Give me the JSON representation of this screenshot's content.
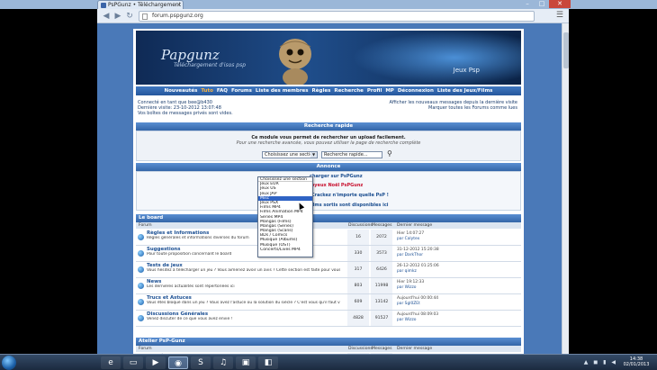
{
  "browser": {
    "tab_title": "PsPGunz • Téléchargement",
    "url": "forum.pspgunz.org",
    "window_buttons": [
      "–",
      "□",
      "✕"
    ]
  },
  "banner": {
    "logo": "Papgunz",
    "logo_sub": "Téléchargement d'isos psp",
    "right_text": "Jeux Psp"
  },
  "navbar": [
    {
      "label": "Nouveautés",
      "highlight": false
    },
    {
      "label": "Tuto",
      "highlight": true
    },
    {
      "label": "FAQ",
      "highlight": false
    },
    {
      "label": "Forums",
      "highlight": false
    },
    {
      "label": "Liste des membres",
      "highlight": false
    },
    {
      "label": "Règles",
      "highlight": false
    },
    {
      "label": "Recherche",
      "highlight": false
    },
    {
      "label": "Profil",
      "highlight": false
    },
    {
      "label": "MP",
      "highlight": false
    },
    {
      "label": "Déconnexion",
      "highlight": false
    },
    {
      "label": "Liste des Jeux/Films",
      "highlight": false
    }
  ],
  "info": {
    "left_lines": [
      "Connecté en tant que bee@b430",
      "Dernière visite: 23-10-2012 13:07:48",
      "Vos boîtes de messages privés sont vides."
    ],
    "right_lines": [
      "Afficher les nouveaux messages depuis la dernière visite",
      "Marquer toutes les Forums comme lues"
    ]
  },
  "quick_search": {
    "header": "Recherche rapide",
    "line1": "Ce module vous permet de rechercher un upload facilement.",
    "line2": "Pour une recherche avancée, vous pouvez utiliser la page de recherche complète",
    "select_value": "Choisissez une section",
    "search_value": "Recherche rapide...",
    "dropdown_options": [
      "Choisissez une section",
      "Jeux EUR",
      "Jeux US",
      "Jeux JAP",
      "Misc",
      "Jeux PSX",
      "Films MP4",
      "Films Animation MP4",
      "Series MP4",
      "Mangas (Films)",
      "Mangas (Series)",
      "Mangas (Scans)",
      "BDs / Comics",
      "Musique (Albums)",
      "Musique (OST)",
      "Concerts/Lives MP4"
    ],
    "selected_index": 4
  },
  "annonce": {
    "header": "Annonce",
    "lines": [
      "charger sur PsPGunz",
      "Joyeux Noël PsPGunz",
      "/Crackez n'importe quelle PsP !",
      "films sortis sont disponibles ici"
    ]
  },
  "le_board": {
    "header": "Le board",
    "col_forum": "Forum",
    "col_disc": "Discussions",
    "col_msg": "Messages",
    "col_last": "Dernier message",
    "rows": [
      {
        "title": "Règles et Informations",
        "desc": "Règles générales et informations diverses du forum",
        "disc": "16",
        "msg": "2072",
        "last_date": "Hier 14:07:27",
        "last_by": "par Calytex"
      },
      {
        "title": "Suggestions",
        "desc": "Pour toute proposition concernant le board",
        "disc": "330",
        "msg": "3573",
        "last_date": "31-12-2012 15:20:38",
        "last_by": "par DarkThor"
      },
      {
        "title": "Tests de jeux",
        "desc": "Vous hésitez à télécharger un jeu ? Vous aimeriez avoir un avis ? Cette section est faite pour vous !",
        "disc": "317",
        "msg": "6426",
        "last_date": "26-12-2012 01:25:06",
        "last_by": "par qimkz"
      },
      {
        "title": "News",
        "desc": "Les dernières actualités sont répertoriées ici",
        "disc": "803",
        "msg": "11998",
        "last_date": "Hier 19:12:33",
        "last_by": "par Wizzo"
      },
      {
        "title": "Trucs et Astuces",
        "desc": "Vous êtes bloqué dans un jeu ? Vous avez l'astuce ou la solution du siècle ? C'est vous qu'il faut venir poster !",
        "disc": "609",
        "msg": "13142",
        "last_date": "Aujourd'hui 00:00:44",
        "last_by": "par Sgl0ZEt"
      },
      {
        "title": "Discussions Générales",
        "desc": "Venez discuter de ce que vous avez envie !",
        "disc": "4828",
        "msg": "91527",
        "last_date": "Aujourd'hui 08:09:03",
        "last_by": "par Wizzo"
      }
    ]
  },
  "atelier": {
    "header": "Atelier PsP-Gunz",
    "col_forum": "Forum",
    "col_disc": "Discussions",
    "col_msg": "Messages",
    "col_last": "Dernier message",
    "rows": [
      {
        "title": "Mise à jour PsP",
        "desc": "Mettez à jour votre Custom Firmware pour jouer à tous les jeux",
        "disc": "74",
        "msg": "6200",
        "last_date": "Hier 17:29:29",
        "last_by": "par Play58"
      },
      {
        "title": "Tutoriels",
        "desc": "Tous les tutoriels utiles sont répertoriés dans cette section",
        "disc": "348",
        "msg": "7210",
        "last_date": "Hier 19:40:13",
        "last_by": "par KEVIN"
      }
    ]
  },
  "taskbar": {
    "items": [
      "ie",
      "folder",
      "media",
      "chrome",
      "skype",
      "spotify",
      "app",
      "app2"
    ],
    "tray": "▲ ◼ ▮ ◀",
    "time": "14:38",
    "date": "02/01/2013"
  }
}
